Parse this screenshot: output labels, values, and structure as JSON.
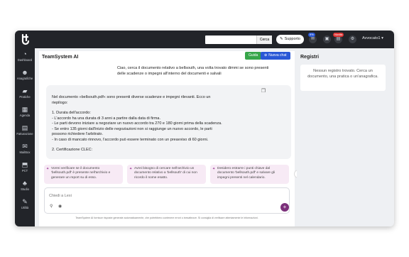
{
  "brand": {
    "logo_text": "t",
    "accent": "#7b2f7a",
    "topbar_bg": "#222429"
  },
  "topbar": {
    "search_placeholder": "",
    "search_button": "Cerca",
    "support_label": "Supporto",
    "icons": [
      {
        "name": "user-icon",
        "glyph": "✉",
        "badge": "9%",
        "badge_color": "#2a58d6"
      },
      {
        "name": "messages-icon",
        "glyph": "▣",
        "badge": "",
        "badge_color": ""
      },
      {
        "name": "notifications-icon",
        "glyph": "▤",
        "badge": "Novità",
        "badge_color": "#d33"
      },
      {
        "name": "settings-icon",
        "glyph": "⚙",
        "badge": "",
        "badge_color": ""
      }
    ],
    "user_name": "Avvocato1"
  },
  "sidebar": {
    "items": [
      {
        "label": "Dashboard",
        "icon": "dashboard-icon",
        "glyph": "◔"
      },
      {
        "label": "Anagrafiche",
        "icon": "people-icon",
        "glyph": "👥"
      },
      {
        "label": "Pratiche",
        "icon": "folder-icon",
        "glyph": "▰"
      },
      {
        "label": "Agenda",
        "icon": "calendar-icon",
        "glyph": "▦"
      },
      {
        "label": "Fatturazione",
        "icon": "invoice-icon",
        "glyph": "▤"
      },
      {
        "label": "MailBox",
        "icon": "mail-icon",
        "glyph": "✉"
      },
      {
        "label": "PCT",
        "icon": "pct-icon",
        "glyph": "⬒"
      },
      {
        "label": "Studio",
        "icon": "studio-icon",
        "glyph": "♣"
      },
      {
        "label": "Utilità",
        "icon": "tools-icon",
        "glyph": "✎"
      }
    ]
  },
  "ai_panel": {
    "title": "TeamSystem AI",
    "guide_label": "Guida",
    "new_chat_label": "Nuova chat",
    "user_message": "Ciao, cerca il documento relativo a bellsouth, una volta trovato dimmi se sono presenti delle scadenze o impegni all'interno del documenti e salvali",
    "bot_message": [
      "Nel documento »bellsouth.pdf« sono presenti diverse scadenze e impegni rilevanti. Ecco un riepilogo:",
      "1. Durata dell'accordo:\n- L'accordo ha una durata di 3 anni a partire dalla data di firma.\n- Le parti devono iniziare a negoziare un nuovo accordo tra 270 e 180 giorni prima della scadenza.\n- Se entro 135 giorni dall'inizio delle negoziazioni non si raggiunge un nuovo accordo, le parti possono richiedere l'arbitrato.\n- In caso di mancato rinnovo, l'accordo può essere terminato con un preavviso di 60 giorni.",
      "2. Certificazione CLEC:"
    ],
    "suggestions": [
      "Vorrei verificare se il documento 'bellsouth.pdf' è presente nell'archivio e generare un report su di esso.",
      "Avrei bisogno di cercare nell'archivio un documento relativo a 'bellsouth' di cui non ricordo il nome esatto.",
      "Desidero estrarre i punti chiave dal documento 'bellsouth.pdf' e salvare gli impegni presenti nel calendario."
    ],
    "input_placeholder": "Chiedi a Lexi",
    "disclaimer": "TeamSystem AI fornisce risposte generate automaticamente, che potrebbero contenere errori o inesattezze. Si consiglia di verificare attentamente le informazioni."
  },
  "registri": {
    "title": "Registri",
    "empty_text": "Nessun registro trovato. Cerca un documento, una pratica o un'anagrafica."
  }
}
